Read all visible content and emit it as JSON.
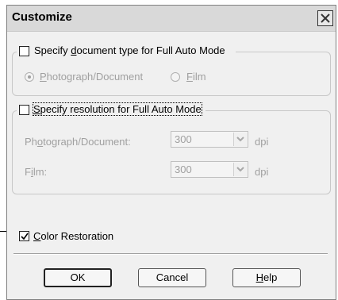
{
  "dialog": {
    "title": "Customize",
    "close_icon": "close-icon"
  },
  "doc_type": {
    "checkbox_label_pre": "Specify ",
    "checkbox_label_u": "d",
    "checkbox_label_post": "ocument type for Full Auto Mode",
    "checked": false,
    "options": [
      {
        "label_u": "P",
        "label_rest": "hotograph/Document",
        "selected": true
      },
      {
        "label_u": "F",
        "label_rest": "ilm",
        "selected": false
      }
    ]
  },
  "resolution": {
    "checkbox_label_u": "S",
    "checkbox_label_rest": "pecify resolution for Full Auto Mode",
    "checked": false,
    "photo_label_pre": "Ph",
    "photo_label_u": "o",
    "photo_label_post": "tograph/Document:",
    "photo_value": "300",
    "film_label_pre": "F",
    "film_label_u": "i",
    "film_label_post": "lm:",
    "film_value": "300",
    "unit": "dpi"
  },
  "color_restoration": {
    "label_u": "C",
    "label_rest": "olor Restoration",
    "checked": true
  },
  "buttons": {
    "ok": "OK",
    "cancel": "Cancel",
    "help_u": "H",
    "help_rest": "elp"
  }
}
